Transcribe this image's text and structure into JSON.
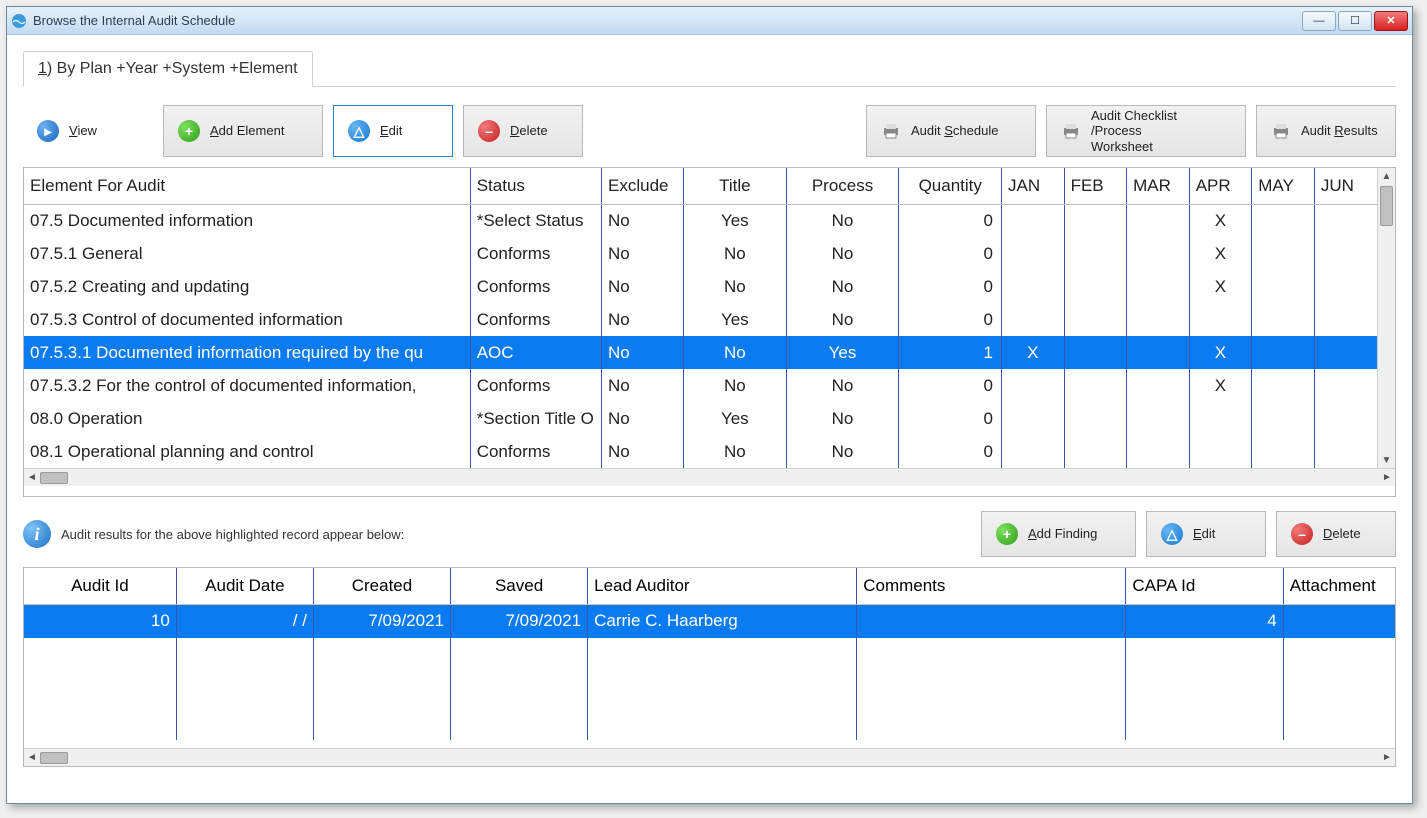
{
  "window": {
    "title": "Browse the Internal Audit Schedule"
  },
  "tab": {
    "label": "1) By Plan +Year +System +Element"
  },
  "toolbar": {
    "view": "View",
    "add_element": "Add Element",
    "edit": "Edit",
    "delete": "Delete",
    "audit_schedule": "Audit Schedule",
    "checklist": "Audit Checklist /Process\nWorksheet",
    "audit_results": "Audit Results"
  },
  "grid": {
    "headers": {
      "element": "Element For Audit",
      "status": "Status",
      "exclude": "Exclude",
      "title": "Title",
      "process": "Process",
      "quantity": "Quantity",
      "months": [
        "JAN",
        "FEB",
        "MAR",
        "APR",
        "MAY",
        "JUN"
      ]
    },
    "rows": [
      {
        "element": "07.5 Documented information",
        "status": "*Select Status",
        "exclude": "No",
        "title": "Yes",
        "process": "No",
        "qty": "0",
        "m": [
          "",
          "",
          "",
          "X",
          "",
          ""
        ],
        "sel": false
      },
      {
        "element": "07.5.1 General",
        "status": "Conforms",
        "exclude": "No",
        "title": "No",
        "process": "No",
        "qty": "0",
        "m": [
          "",
          "",
          "",
          "X",
          "",
          ""
        ],
        "sel": false
      },
      {
        "element": "07.5.2 Creating and updating",
        "status": "Conforms",
        "exclude": "No",
        "title": "No",
        "process": "No",
        "qty": "0",
        "m": [
          "",
          "",
          "",
          "X",
          "",
          ""
        ],
        "sel": false
      },
      {
        "element": "07.5.3 Control of documented information",
        "status": "Conforms",
        "exclude": "No",
        "title": "Yes",
        "process": "No",
        "qty": "0",
        "m": [
          "",
          "",
          "",
          "",
          "",
          ""
        ],
        "sel": false
      },
      {
        "element": "07.5.3.1 Documented information required by the qu",
        "status": "AOC",
        "exclude": "No",
        "title": "No",
        "process": "Yes",
        "qty": "1",
        "m": [
          "X",
          "",
          "",
          "X",
          "",
          ""
        ],
        "sel": true
      },
      {
        "element": "07.5.3.2 For the control of documented information,",
        "status": "Conforms",
        "exclude": "No",
        "title": "No",
        "process": "No",
        "qty": "0",
        "m": [
          "",
          "",
          "",
          "X",
          "",
          ""
        ],
        "sel": false
      },
      {
        "element": "08.0 Operation",
        "status": "*Section Title O",
        "exclude": "No",
        "title": "Yes",
        "process": "No",
        "qty": "0",
        "m": [
          "",
          "",
          "",
          "",
          "",
          ""
        ],
        "sel": false
      },
      {
        "element": "08.1 Operational planning and control",
        "status": "Conforms",
        "exclude": "No",
        "title": "No",
        "process": "No",
        "qty": "0",
        "m": [
          "",
          "",
          "",
          "",
          "",
          ""
        ],
        "sel": false
      }
    ]
  },
  "info": {
    "text": "Audit results for the above highlighted record appear below:"
  },
  "toolbar2": {
    "add_finding": "Add Finding",
    "edit": "Edit",
    "delete": "Delete"
  },
  "grid2": {
    "headers": {
      "audit_id": "Audit Id",
      "audit_date": "Audit Date",
      "created": "Created",
      "saved": "Saved",
      "lead": "Lead Auditor",
      "comments": "Comments",
      "capa": "CAPA Id",
      "attachment": "Attachment"
    },
    "rows": [
      {
        "id": "10",
        "date": "/  /",
        "created": "7/09/2021",
        "saved": "7/09/2021",
        "lead": "Carrie C. Haarberg",
        "comments": "",
        "capa": "4",
        "att": "",
        "sel": true
      }
    ]
  }
}
